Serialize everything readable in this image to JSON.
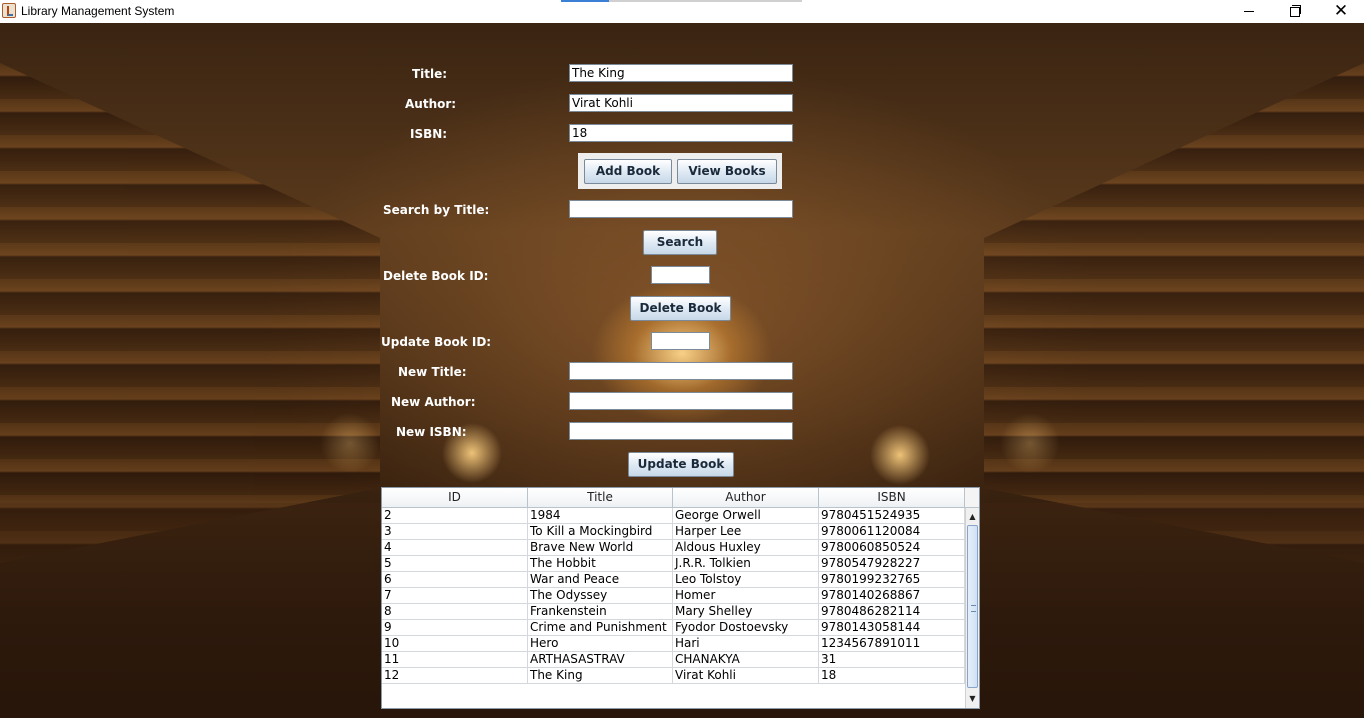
{
  "window": {
    "title": "Library Management System",
    "close_glyph": "✕"
  },
  "form": {
    "title_label": "Title:",
    "title_value": "The King",
    "author_label": "Author:",
    "author_value": "Virat Kohli",
    "isbn_label": "ISBN:",
    "isbn_value": "18",
    "add_button": "Add Book",
    "view_button": "View Books",
    "search_label": "Search by Title:",
    "search_value": "",
    "search_button": "Search",
    "delete_label": "Delete Book ID:",
    "delete_value": "",
    "delete_button": "Delete Book",
    "update_id_label": "Update Book ID:",
    "update_id_value": "",
    "new_title_label": "New Title:",
    "new_title_value": "",
    "new_author_label": "New Author:",
    "new_author_value": "",
    "new_isbn_label": "New ISBN:",
    "new_isbn_value": "",
    "update_button": "Update Book"
  },
  "table": {
    "columns": [
      "ID",
      "Title",
      "Author",
      "ISBN"
    ],
    "rows": [
      [
        "2",
        "1984",
        "George Orwell",
        "9780451524935"
      ],
      [
        "3",
        "To Kill a Mockingbird",
        "Harper Lee",
        "9780061120084"
      ],
      [
        "4",
        "Brave New World",
        "Aldous Huxley",
        "9780060850524"
      ],
      [
        "5",
        "The Hobbit",
        "J.R.R. Tolkien",
        "9780547928227"
      ],
      [
        "6",
        "War and Peace",
        "Leo Tolstoy",
        "9780199232765"
      ],
      [
        "7",
        "The Odyssey",
        "Homer",
        "9780140268867"
      ],
      [
        "8",
        "Frankenstein",
        "Mary Shelley",
        "9780486282114"
      ],
      [
        "9",
        "Crime and Punishment",
        "Fyodor Dostoevsky",
        "9780143058144"
      ],
      [
        "10",
        "Hero",
        "Hari",
        "1234567891011"
      ],
      [
        "11",
        "ARTHASASTRAV",
        "CHANAKYA",
        "31"
      ],
      [
        "12",
        "The King",
        "Virat Kohli",
        "18"
      ]
    ]
  },
  "icons": {
    "app": "java-cup-icon",
    "minimize": "minimize-icon",
    "maximize": "restore-icon",
    "close": "close-icon",
    "scroll_up": "scroll-up-arrow-icon",
    "scroll_down": "scroll-down-arrow-icon"
  }
}
